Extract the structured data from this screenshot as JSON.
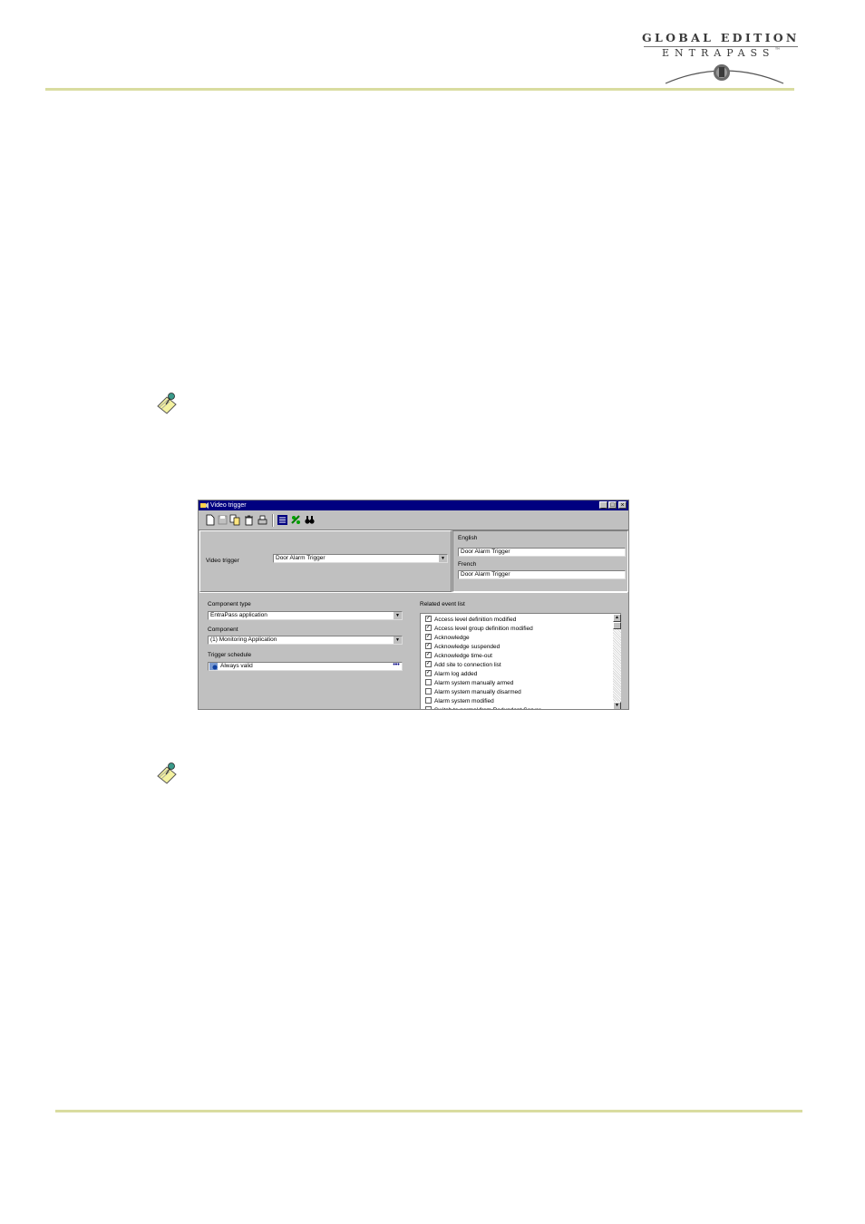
{
  "logo": {
    "line1": "GLOBAL EDITION",
    "line2": "ENTRAPASS",
    "tm": "™"
  },
  "window": {
    "title": "Video trigger",
    "controls": {
      "minimize": "_",
      "maximize": "□",
      "close": "×"
    },
    "toolbar": [
      "new-icon",
      "save-icon",
      "copy-icon",
      "delete-icon",
      "print-icon",
      "list-icon",
      "link-icon",
      "find-icon"
    ],
    "video_trigger_label": "Video trigger",
    "video_trigger_value": "Door Alarm Trigger",
    "english_label": "English",
    "english_value": "Door Alarm Trigger",
    "french_label": "French",
    "french_value": "Door Alarm Trigger",
    "component_type_label": "Component type",
    "component_type_value": "EntraPass application",
    "component_label": "Component",
    "component_value": "(1) Monitoring Application",
    "trigger_schedule_label": "Trigger schedule",
    "trigger_schedule_value": "Always valid",
    "ellipsis": "•••",
    "related_event_label": "Related event list",
    "events": [
      {
        "label": "Access level definition modified",
        "checked": true
      },
      {
        "label": "Access level group definition modified",
        "checked": true
      },
      {
        "label": "Acknowledge",
        "checked": true
      },
      {
        "label": "Acknowledge suspended",
        "checked": true
      },
      {
        "label": "Acknowledge time-out",
        "checked": true
      },
      {
        "label": "Add site to connection list",
        "checked": true
      },
      {
        "label": "Alarm log added",
        "checked": true
      },
      {
        "label": "Alarm system manually armed",
        "checked": false
      },
      {
        "label": "Alarm system manually disarmed",
        "checked": false
      },
      {
        "label": "Alarm system modified",
        "checked": false
      },
      {
        "label": "Switch to normal from Redundant Server",
        "checked": false
      }
    ],
    "check_mark": "✓",
    "arrow_down": "▼",
    "arrow_up": "▲"
  }
}
